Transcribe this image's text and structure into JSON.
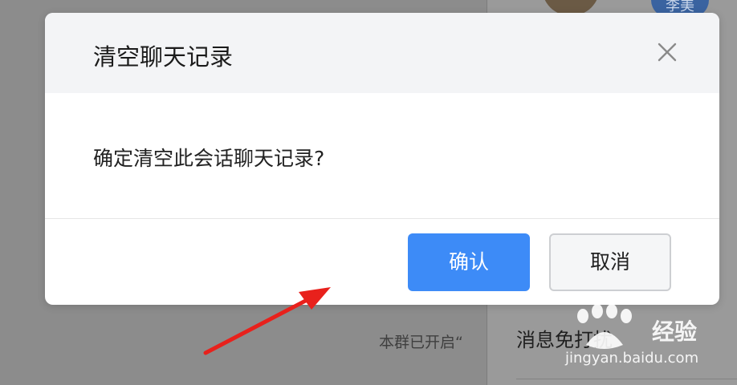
{
  "dialog": {
    "title": "清空聊天记录",
    "message": "确定清空此会话聊天记录?",
    "confirm_label": "确认",
    "cancel_label": "取消"
  },
  "background": {
    "group_note": "本群已开启“",
    "side_badge": "李美",
    "side_heading": "消息免打扰"
  },
  "watermark": {
    "brand": "经验",
    "domain": "jingyan.baidu.com"
  },
  "colors": {
    "primary": "#3d8bf7",
    "overlay": "#8c8c8c",
    "arrow": "#e8211c"
  }
}
